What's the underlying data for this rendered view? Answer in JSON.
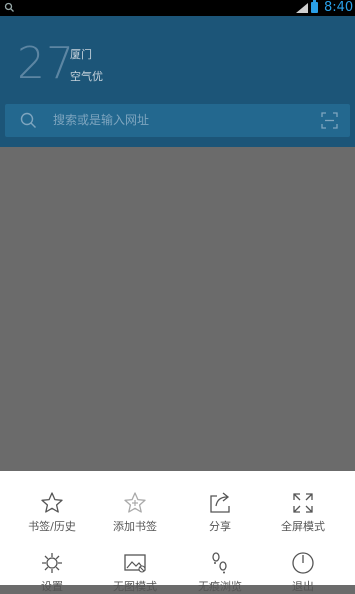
{
  "status_bar": {
    "time": "8:40",
    "icons": [
      "search-icon",
      "signal-icon",
      "battery-icon"
    ]
  },
  "header": {
    "temperature": "27",
    "city": "厦门",
    "air_quality": "空气优"
  },
  "search": {
    "placeholder": "搜索或是输入网址",
    "icons": [
      "search-icon",
      "scan-icon"
    ]
  },
  "menu": {
    "row1": [
      {
        "label": "书签/历史",
        "icon": "star-icon"
      },
      {
        "label": "添加书签",
        "icon": "add-bookmark-icon"
      },
      {
        "label": "分享",
        "icon": "share-icon"
      },
      {
        "label": "全屏模式",
        "icon": "fullscreen-icon"
      }
    ],
    "row2": [
      {
        "label": "设置",
        "icon": "settings-icon"
      },
      {
        "label": "无图模式",
        "icon": "no-image-icon"
      },
      {
        "label": "无痕浏览",
        "icon": "incognito-icon"
      },
      {
        "label": "退出",
        "icon": "power-icon"
      }
    ]
  }
}
